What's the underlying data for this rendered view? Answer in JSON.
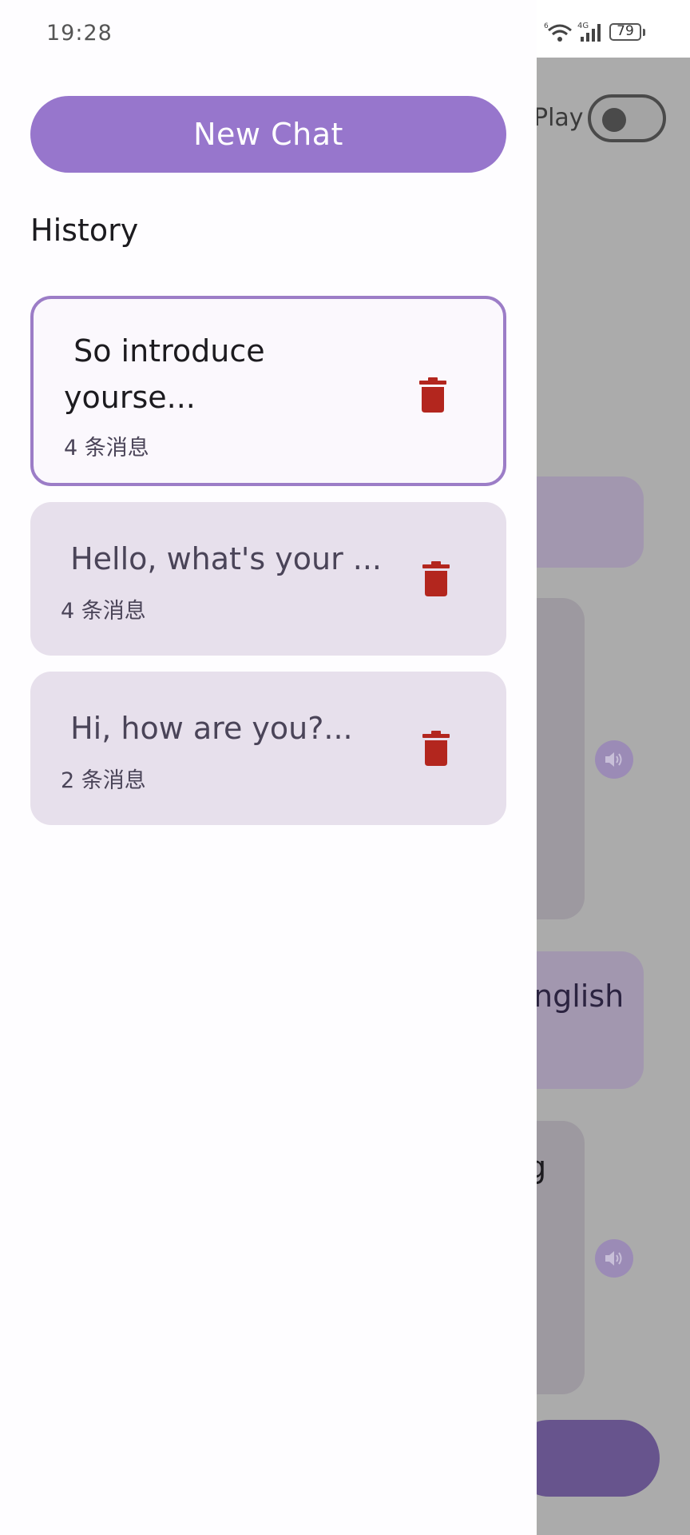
{
  "status_bar": {
    "time": "19:28",
    "battery": "79",
    "network": "4G"
  },
  "background_screen": {
    "autoplay_label": "Play",
    "bubble_fragment_1": "nglish",
    "bubble_fragment_2": "g"
  },
  "drawer": {
    "new_chat_label": "New Chat",
    "history_heading": "History",
    "items": [
      {
        "title": " So introduce\nyourse...",
        "count": "4 条消息",
        "active": true
      },
      {
        "title": " Hello, what's your ...",
        "count": "4 条消息",
        "active": false
      },
      {
        "title": " Hi, how are you?...",
        "count": "2 条消息",
        "active": false
      }
    ]
  },
  "colors": {
    "primary": "#9776cc",
    "card_bg": "#e7e0ec",
    "active_border": "#9c7dc7",
    "delete_icon": "#b3261e",
    "scrim": "#ababab"
  }
}
